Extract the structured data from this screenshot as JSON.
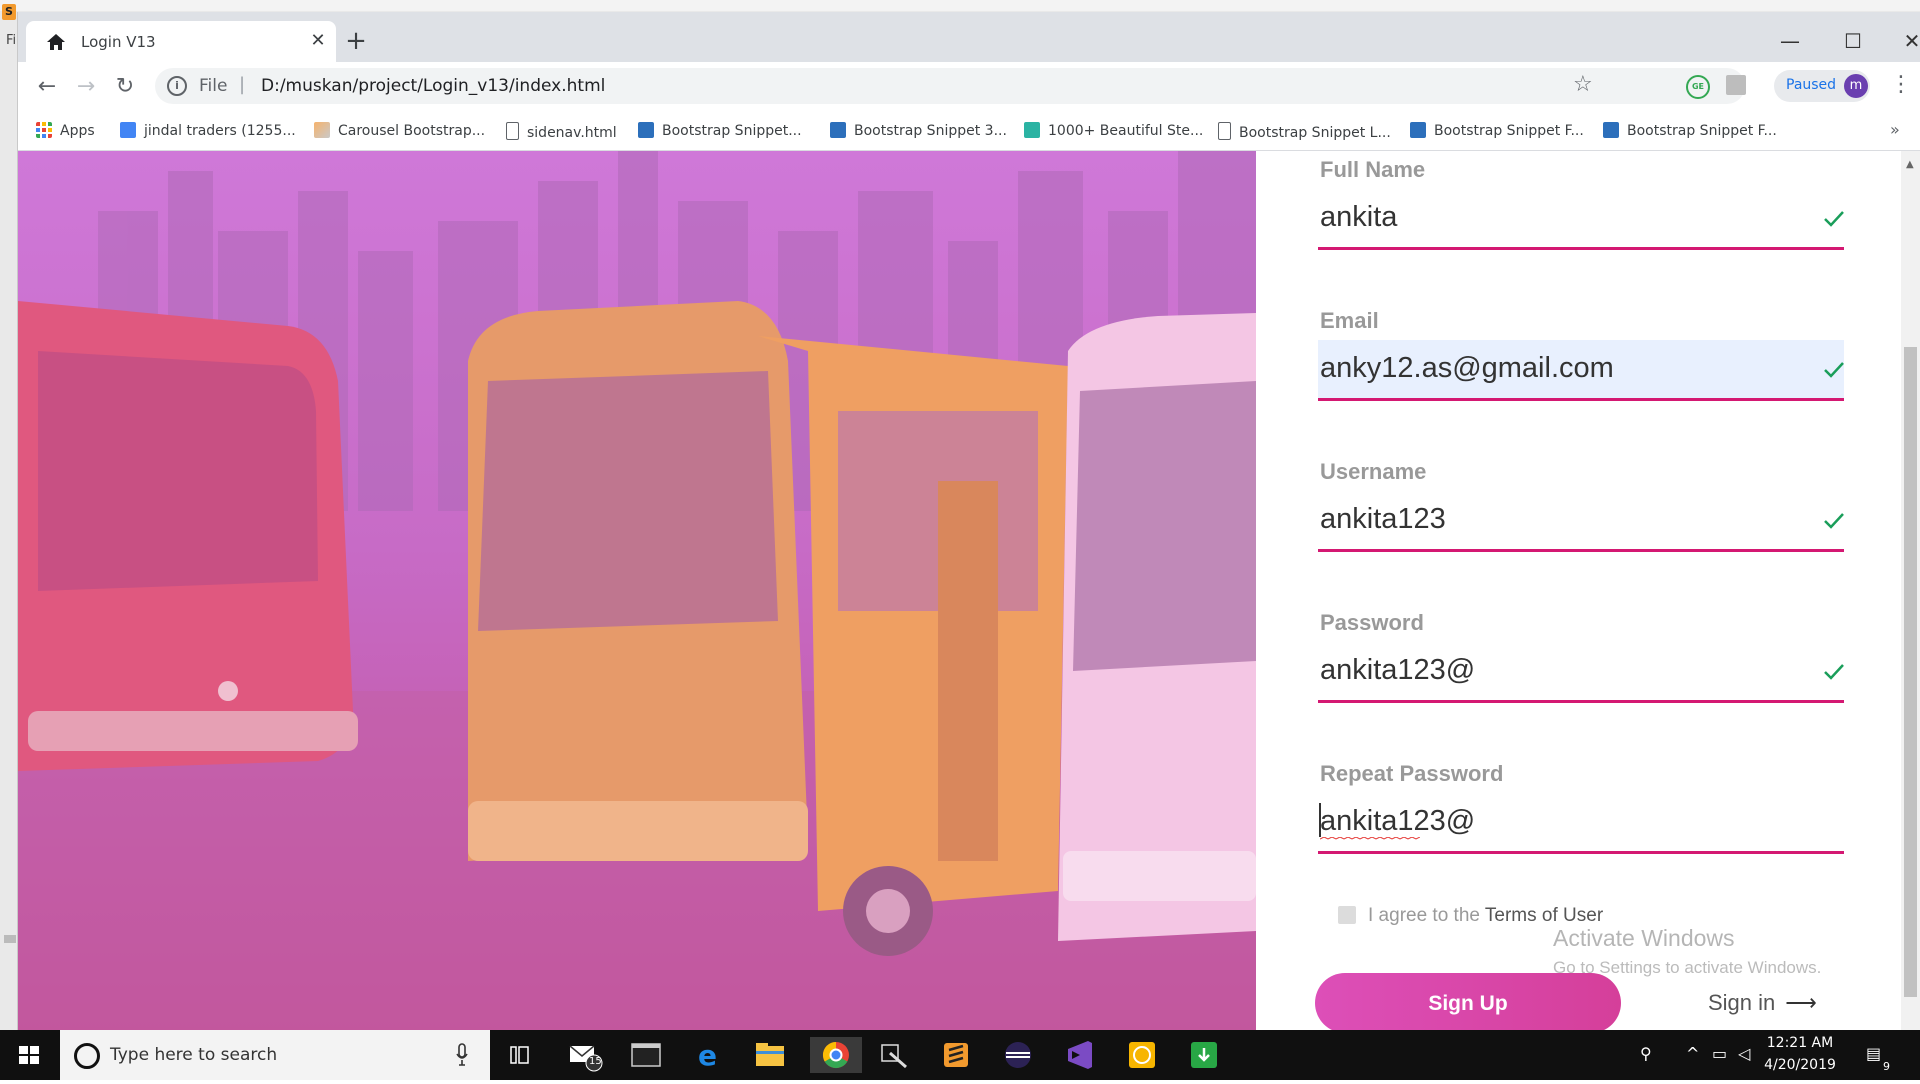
{
  "browser": {
    "tab_title": "Login V13",
    "omnibox": {
      "scheme_label": "File",
      "separator": "|",
      "url": "D:/muskan/project/Login_v13/index.html"
    },
    "profile_status": "Paused",
    "profile_initial": "m",
    "bookmarks": [
      {
        "label": "Apps",
        "icon": "apps-grid-icon"
      },
      {
        "label": "jindal traders (1255...",
        "icon": "doc-blue-icon"
      },
      {
        "label": "Carousel Bootstrap...",
        "icon": "image-icon"
      },
      {
        "label": "sidenav.html",
        "icon": "page-icon"
      },
      {
        "label": "Bootstrap Snippet...",
        "icon": "bootsnipp-icon"
      },
      {
        "label": "Bootstrap Snippet 3...",
        "icon": "bootsnipp-icon"
      },
      {
        "label": "1000+ Beautiful Ste...",
        "icon": "teal-icon"
      },
      {
        "label": "Bootstrap Snippet L...",
        "icon": "page-icon"
      },
      {
        "label": "Bootstrap Snippet F...",
        "icon": "bootsnipp-icon"
      },
      {
        "label": "Bootstrap Snippet F...",
        "icon": "bootsnipp-icon"
      }
    ],
    "bookmarks_overflow": "»"
  },
  "behind_window": {
    "menu_text": "Fi"
  },
  "form": {
    "fields": [
      {
        "label": "Full Name",
        "value": "ankita",
        "valid": true,
        "autofill": false
      },
      {
        "label": "Email",
        "value": "anky12.as@gmail.com",
        "valid": true,
        "autofill": true
      },
      {
        "label": "Username",
        "value": "ankita123",
        "valid": true,
        "autofill": false
      },
      {
        "label": "Password",
        "value": "ankita123@",
        "valid": true,
        "autofill": false
      },
      {
        "label": "Repeat Password",
        "value": "ankita123@",
        "valid": false,
        "autofill": false,
        "focused": true
      }
    ],
    "agree_prefix": "I agree to the ",
    "agree_link": "Terms of User",
    "submit_label": "Sign Up",
    "signin_label": "Sign in",
    "signin_arrow": "⟶"
  },
  "watermark": {
    "title": "Activate Windows",
    "subtitle": "Go to Settings to activate Windows."
  },
  "taskbar": {
    "search_placeholder": "Type here to search",
    "mail_badge": "15",
    "time": "12:21 AM",
    "date": "4/20/2019",
    "notification_count": "9"
  },
  "colors": {
    "accent": "#d41872",
    "check_green": "#1a9e5a",
    "hero_top": "#cf78d8",
    "hero_bottom": "#c04f97",
    "button_start": "#dd4fb8",
    "button_end": "#d53f9a"
  }
}
